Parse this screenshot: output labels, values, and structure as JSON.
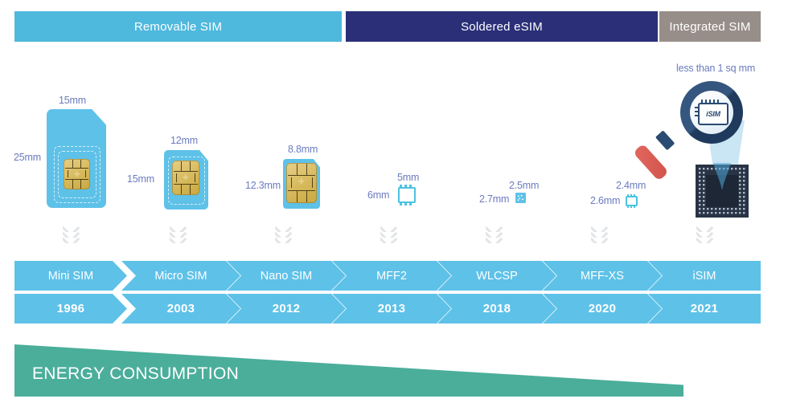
{
  "categories": [
    {
      "label": "Removable SIM",
      "color": "#4fb8dd"
    },
    {
      "label": "Soldered eSIM",
      "color": "#2a2f78"
    },
    {
      "label": "Integrated SIM",
      "color": "#978e8a"
    }
  ],
  "form_factors": [
    {
      "name": "Mini SIM",
      "year": "1996",
      "width_label": "15mm",
      "height_label": "25mm",
      "art": "sim-card"
    },
    {
      "name": "Micro SIM",
      "year": "2003",
      "width_label": "12mm",
      "height_label": "15mm",
      "art": "sim-card"
    },
    {
      "name": "Nano SIM",
      "year": "2012",
      "width_label": "8.8mm",
      "height_label": "12.3mm",
      "art": "sim-card"
    },
    {
      "name": "MFF2",
      "year": "2013",
      "width_label": "5mm",
      "height_label": "6mm",
      "art": "ic-chip"
    },
    {
      "name": "WLCSP",
      "year": "2018",
      "width_label": "2.5mm",
      "height_label": "2.7mm",
      "art": "wlcsp-square"
    },
    {
      "name": "MFF-XS",
      "year": "2020",
      "width_label": "2.4mm",
      "height_label": "2.6mm",
      "art": "ic-chip"
    },
    {
      "name": "iSIM",
      "year": "2021",
      "width_label": "",
      "height_label": "",
      "art": "magnifier"
    }
  ],
  "isim": {
    "caption": "less than 1 sq mm",
    "chip_label": "iSIM"
  },
  "energy": {
    "label": "ENERGY CONSUMPTION",
    "color": "#4aae9b"
  },
  "palette": {
    "sim_blue": "#5ec1e8",
    "dim_text": "#6b7bbf",
    "chevron_gray": "#e2e5e8",
    "navy": "#2a4b72",
    "handle_red": "#d1544c"
  }
}
